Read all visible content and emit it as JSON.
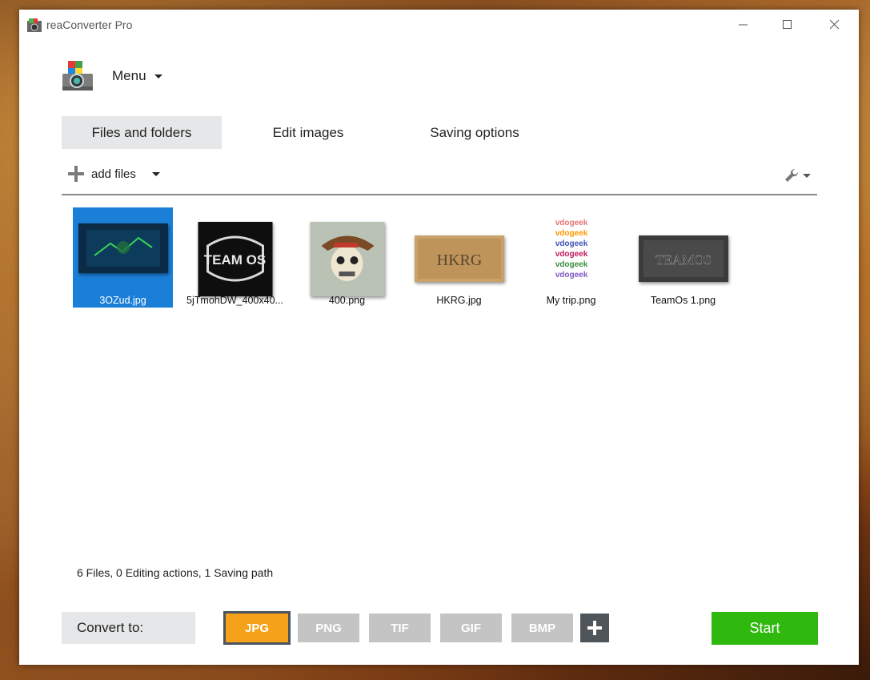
{
  "window": {
    "title": "reaConverter Pro",
    "controls": [
      "minimize-icon",
      "maximize-icon",
      "close-icon"
    ]
  },
  "menu": {
    "label": "Menu"
  },
  "tabs": [
    {
      "label": "Files and folders",
      "active": true
    },
    {
      "label": "Edit images",
      "active": false
    },
    {
      "label": "Saving options",
      "active": false
    }
  ],
  "toolbar": {
    "add_files_label": "add files",
    "settings_icon": "wrench-icon"
  },
  "files": [
    {
      "name": "3OZud.jpg",
      "selected": true
    },
    {
      "name": "5jTmohDW_400x40...",
      "selected": false,
      "thumb_text": "TEAM OS"
    },
    {
      "name": "400.png",
      "selected": false
    },
    {
      "name": "HKRG.jpg",
      "selected": false,
      "thumb_text": "HKRG"
    },
    {
      "name": "My trip.png",
      "selected": false,
      "thumb_text": "vdogeek"
    },
    {
      "name": "TeamOs 1.png",
      "selected": false,
      "thumb_text": "TEAMOS"
    }
  ],
  "status": {
    "text": "6 Files, 0 Editing actions, 1 Saving path"
  },
  "convert": {
    "label": "Convert to:",
    "formats": [
      {
        "label": "JPG",
        "active": true
      },
      {
        "label": "PNG",
        "active": false
      },
      {
        "label": "TIF",
        "active": false
      },
      {
        "label": "GIF",
        "active": false
      },
      {
        "label": "BMP",
        "active": false
      }
    ],
    "start_label": "Start"
  },
  "colors": {
    "selection": "#1b7fd8",
    "active_format": "#f5a11a",
    "inactive_format": "#c4c4c4",
    "start": "#2fb80e",
    "tab_active_bg": "#e6e7e8"
  }
}
